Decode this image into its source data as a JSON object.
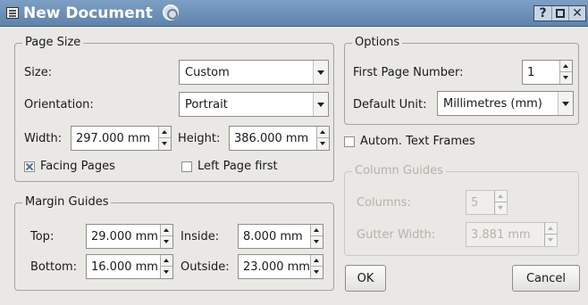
{
  "window": {
    "title": "New Document",
    "help_label": "?",
    "close_label": "✕"
  },
  "page_size": {
    "legend": "Page Size",
    "size_label": "Size:",
    "size_value": "Custom",
    "orientation_label": "Orientation:",
    "orientation_value": "Portrait",
    "width_label": "Width:",
    "width_value": "297.000 mm",
    "height_label": "Height:",
    "height_value": "386.000 mm",
    "facing_pages_label": "Facing Pages",
    "facing_pages_checked": true,
    "left_page_first_label": "Left Page first",
    "left_page_first_checked": false
  },
  "margin_guides": {
    "legend": "Margin Guides",
    "top_label": "Top:",
    "top_value": "29.000 mm",
    "inside_label": "Inside:",
    "inside_value": "8.000 mm",
    "bottom_label": "Bottom:",
    "bottom_value": "16.000 mm",
    "outside_label": "Outside:",
    "outside_value": "23.000 mm"
  },
  "options": {
    "legend": "Options",
    "first_page_label": "First Page Number:",
    "first_page_value": "1",
    "default_unit_label": "Default Unit:",
    "default_unit_value": "Millimetres (mm)"
  },
  "autom_text_frames": {
    "label": "Autom. Text Frames",
    "checked": false
  },
  "column_guides": {
    "legend": "Column Guides",
    "columns_label": "Columns:",
    "columns_value": "5",
    "gutter_label": "Gutter Width:",
    "gutter_value": "3.881 mm"
  },
  "buttons": {
    "ok": "OK",
    "cancel": "Cancel"
  }
}
